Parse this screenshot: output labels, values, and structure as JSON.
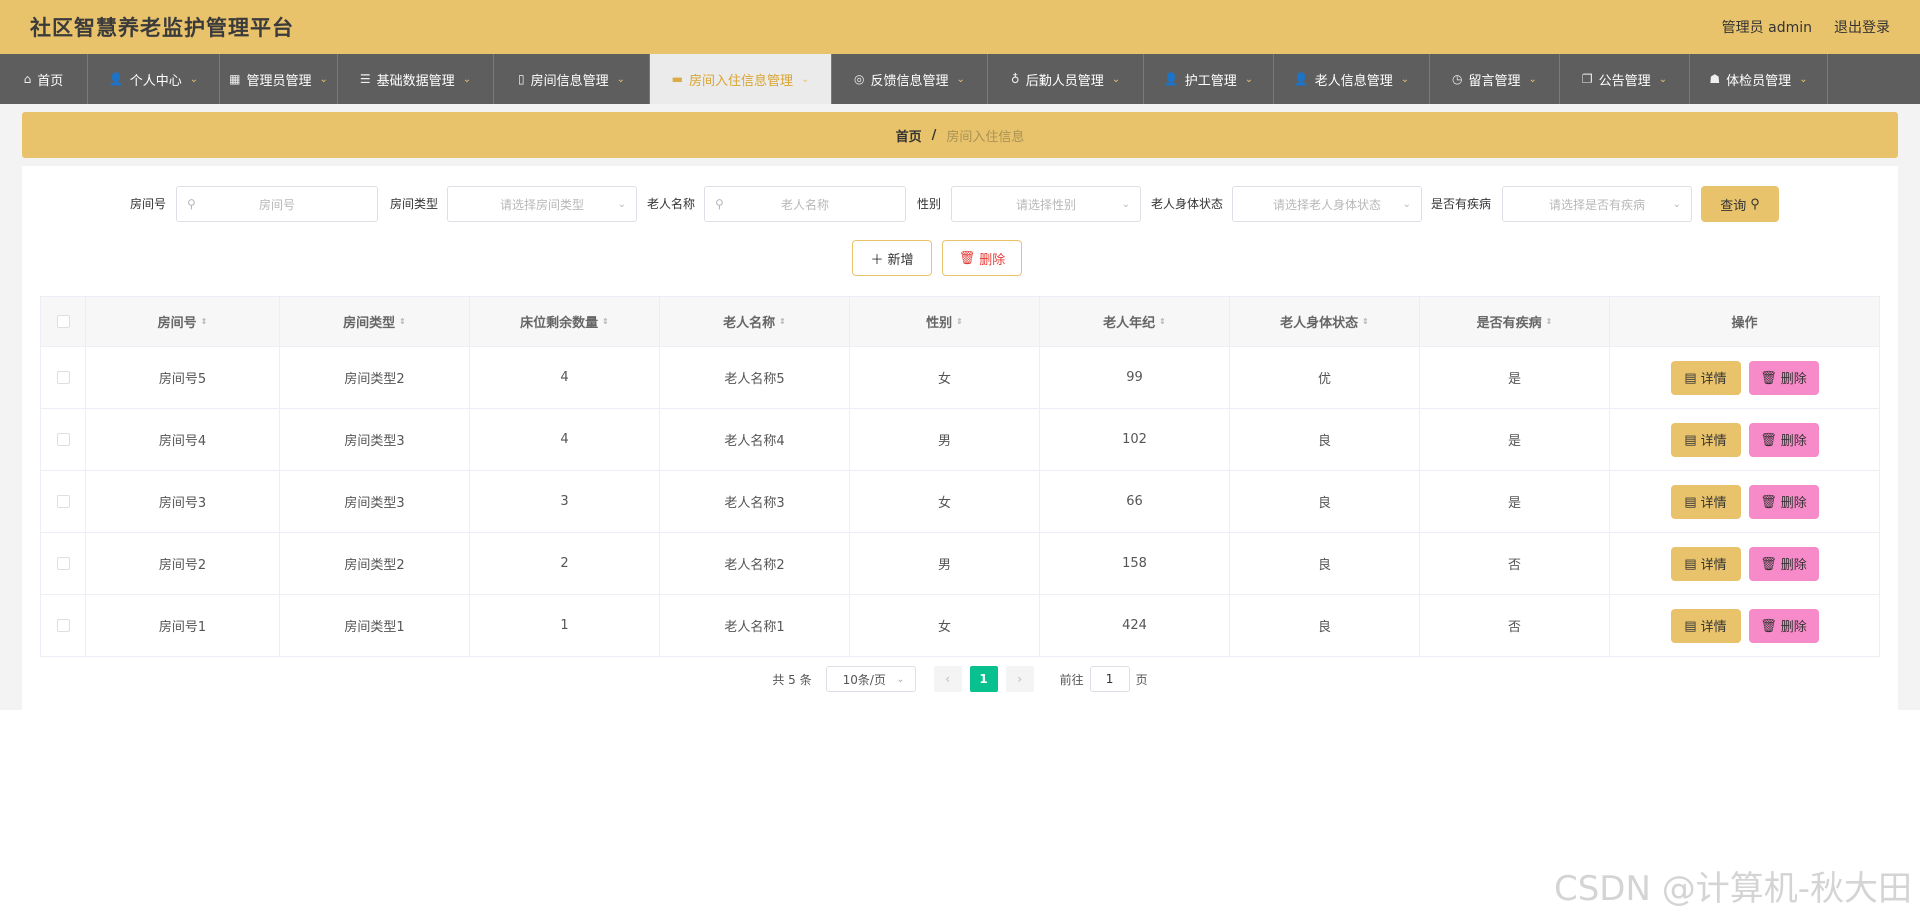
{
  "header": {
    "title": "社区智慧养老监护管理平台",
    "user": "管理员 admin",
    "logout": "退出登录"
  },
  "nav": [
    {
      "label": "首页",
      "icon": "⌂",
      "has_arrow": false,
      "active": false,
      "name": "home"
    },
    {
      "label": "个人中心",
      "icon": "👤",
      "has_arrow": true,
      "active": false,
      "name": "personal-center"
    },
    {
      "label": "管理员管理",
      "icon": "▦",
      "has_arrow": true,
      "active": false,
      "name": "admin-mgmt"
    },
    {
      "label": "基础数据管理",
      "icon": "☰",
      "has_arrow": true,
      "active": false,
      "name": "base-data-mgmt"
    },
    {
      "label": "房间信息管理",
      "icon": "▯",
      "has_arrow": true,
      "active": false,
      "name": "room-info-mgmt"
    },
    {
      "label": "房间入住信息管理",
      "icon": "▬",
      "has_arrow": true,
      "active": true,
      "name": "room-checkin-mgmt"
    },
    {
      "label": "反馈信息管理",
      "icon": "◎",
      "has_arrow": true,
      "active": false,
      "name": "feedback-mgmt"
    },
    {
      "label": "后勤人员管理",
      "icon": "♁",
      "has_arrow": true,
      "active": false,
      "name": "logistics-mgmt"
    },
    {
      "label": "护工管理",
      "icon": "👤",
      "has_arrow": true,
      "active": false,
      "name": "caregiver-mgmt"
    },
    {
      "label": "老人信息管理",
      "icon": "👤",
      "has_arrow": true,
      "active": false,
      "name": "elder-info-mgmt"
    },
    {
      "label": "留言管理",
      "icon": "◷",
      "has_arrow": true,
      "active": false,
      "name": "message-mgmt"
    },
    {
      "label": "公告管理",
      "icon": "❐",
      "has_arrow": true,
      "active": false,
      "name": "notice-mgmt"
    },
    {
      "label": "体检员管理",
      "icon": "☗",
      "has_arrow": true,
      "active": false,
      "name": "examiner-mgmt"
    }
  ],
  "breadcrumb": {
    "home": "首页",
    "sep": "/",
    "current": "房间入住信息"
  },
  "search": {
    "room_no_label": "房间号",
    "room_no_placeholder": "房间号",
    "room_type_label": "房间类型",
    "room_type_placeholder": "请选择房间类型",
    "elder_name_label": "老人名称",
    "elder_name_placeholder": "老人名称",
    "gender_label": "性别",
    "gender_placeholder": "请选择性别",
    "health_label": "老人身体状态",
    "health_placeholder": "请选择老人身体状态",
    "disease_label": "是否有疾病",
    "disease_placeholder": "请选择是否有疾病",
    "query_label": "查询"
  },
  "actions": {
    "add_label": "新增",
    "delete_label": "删除"
  },
  "table": {
    "columns": [
      "房间号",
      "房间类型",
      "床位剩余数量",
      "老人名称",
      "性别",
      "老人年纪",
      "老人身体状态",
      "是否有疾病",
      "操作"
    ],
    "detail_label": "详情",
    "delete_label": "删除",
    "rows": [
      [
        "房间号5",
        "房间类型2",
        "4",
        "老人名称5",
        "女",
        "99",
        "优",
        "是"
      ],
      [
        "房间号4",
        "房间类型3",
        "4",
        "老人名称4",
        "男",
        "102",
        "良",
        "是"
      ],
      [
        "房间号3",
        "房间类型3",
        "3",
        "老人名称3",
        "女",
        "66",
        "良",
        "是"
      ],
      [
        "房间号2",
        "房间类型2",
        "2",
        "老人名称2",
        "男",
        "158",
        "良",
        "否"
      ],
      [
        "房间号1",
        "房间类型1",
        "1",
        "老人名称1",
        "女",
        "424",
        "良",
        "否"
      ]
    ]
  },
  "pager": {
    "total": "共 5 条",
    "page_size": "10条/页",
    "current_page": "1",
    "goto_prefix": "前往",
    "goto_value": "1",
    "goto_suffix": "页"
  },
  "watermark": "CSDN @计算机-秋大田"
}
